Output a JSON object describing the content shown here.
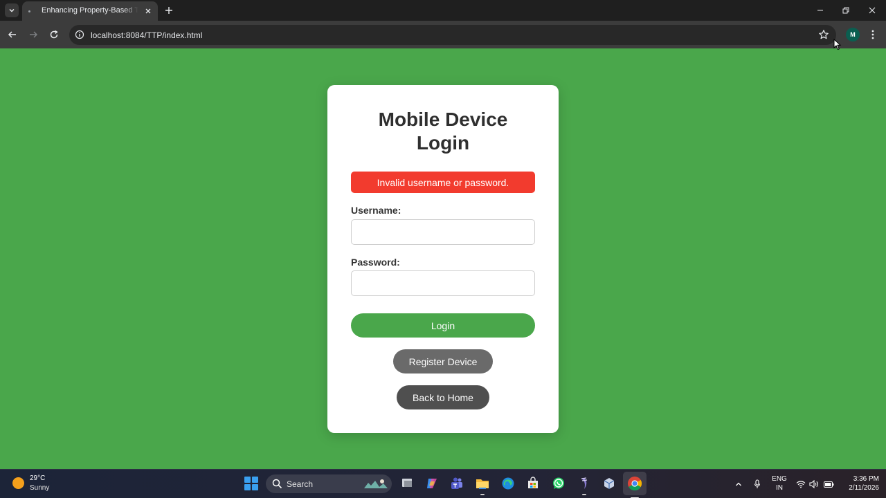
{
  "browser": {
    "tab_title": "Enhancing Property-Based Token",
    "url": "localhost:8084/TTP/index.html",
    "profile_initial": "M"
  },
  "page": {
    "title": "Mobile Device Login",
    "error_message": "Invalid username or password.",
    "username_label": "Username:",
    "username_value": "",
    "password_label": "Password:",
    "password_value": "",
    "login_button": "Login",
    "register_button": "Register Device",
    "home_button": "Back to Home"
  },
  "taskbar": {
    "weather_temp": "29°C",
    "weather_desc": "Sunny",
    "search_label": "Search",
    "language_line1": "ENG",
    "language_line2": "IN",
    "time": "3:36 PM",
    "date": "2/11/2026"
  },
  "colors": {
    "page_background": "#4aa74b",
    "login_button": "#4aa74b",
    "error_background": "#f23b2e",
    "register_button": "#6a6a6a",
    "home_button": "#4f4f4f"
  },
  "icons": [
    "chevron-down-icon",
    "close-icon",
    "plus-icon",
    "minimize-icon",
    "restore-icon",
    "back-icon",
    "forward-icon",
    "reload-icon",
    "info-icon",
    "star-icon",
    "more-icon",
    "windows-start-icon",
    "search-icon",
    "task-view-icon",
    "copilot-icon",
    "teams-icon",
    "file-explorer-icon",
    "edge-icon",
    "store-icon",
    "whatsapp-icon",
    "eclipse-icon",
    "virtualbox-icon",
    "chrome-icon",
    "chevron-up-icon",
    "microphone-icon",
    "wifi-icon",
    "volume-icon",
    "battery-icon"
  ]
}
